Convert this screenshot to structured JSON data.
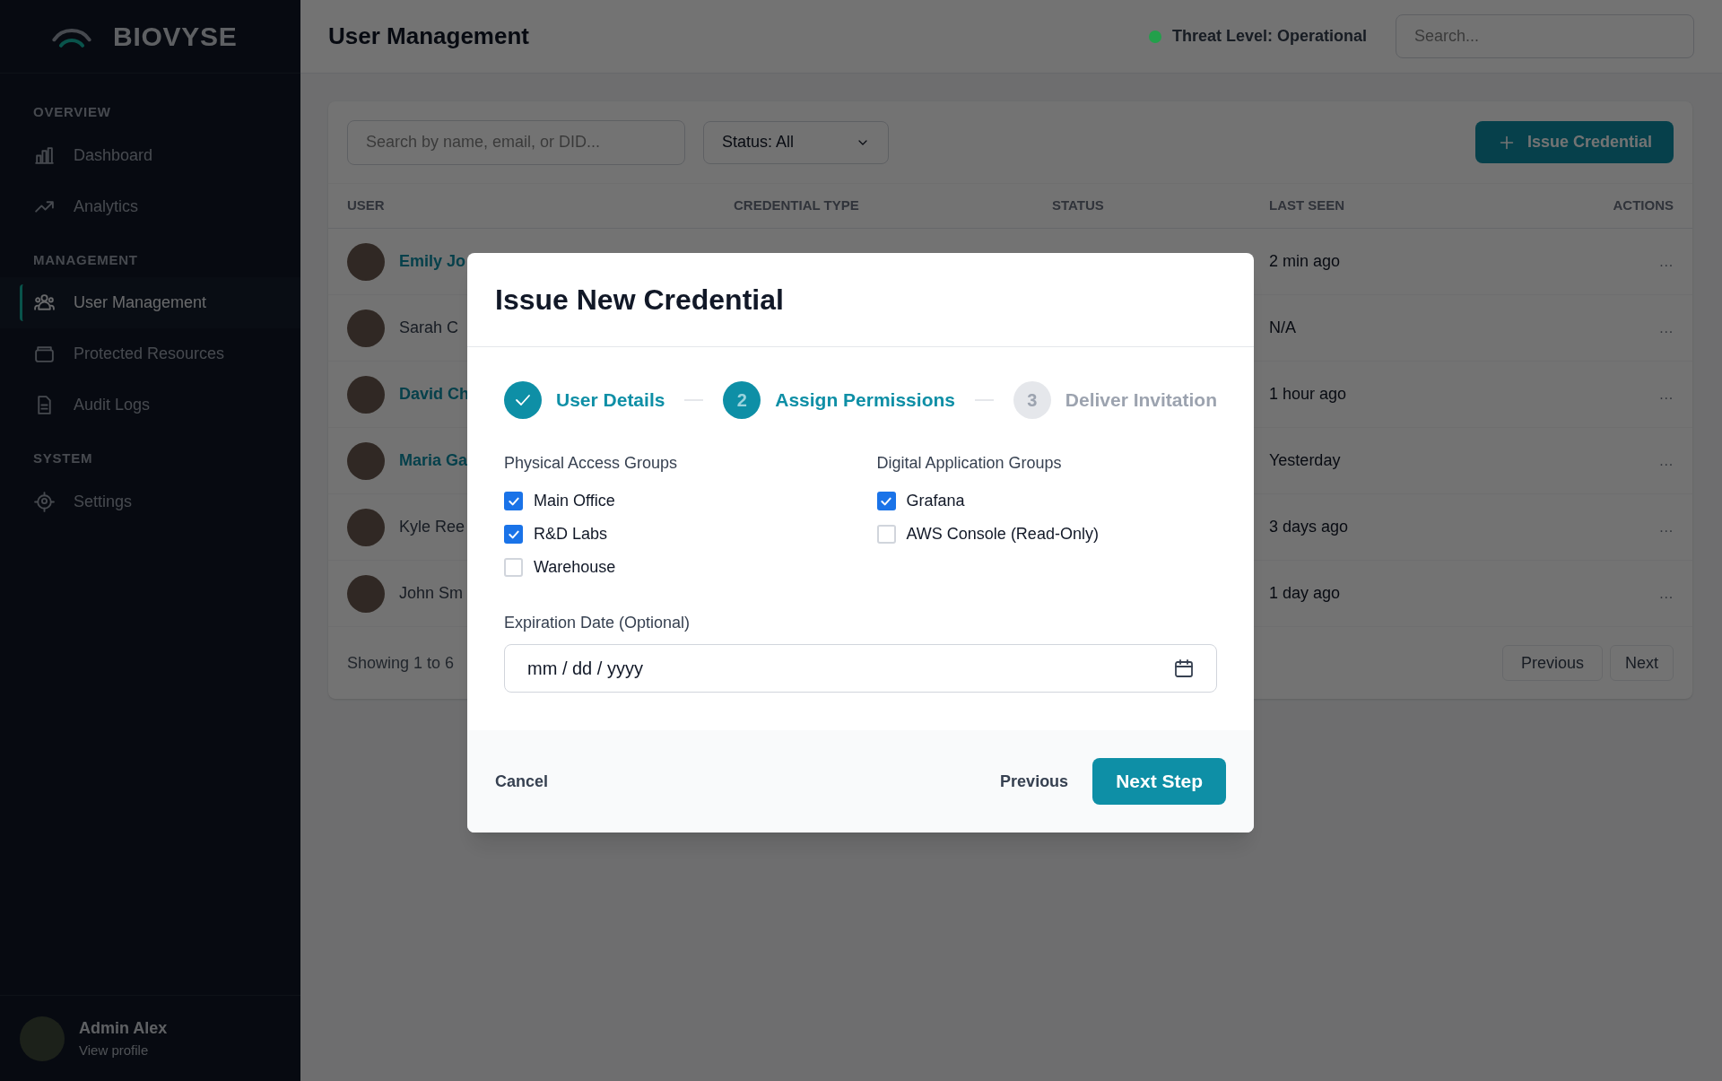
{
  "sidebar": {
    "brand": "BIOVYSE",
    "sections": [
      {
        "title": "OVERVIEW",
        "items": [
          {
            "label": "Dashboard",
            "kind": "bars",
            "selected": false
          },
          {
            "label": "Analytics",
            "kind": "trend",
            "selected": false
          }
        ]
      },
      {
        "title": "MANAGEMENT",
        "items": [
          {
            "label": "User Management",
            "kind": "users",
            "selected": true
          },
          {
            "label": "Protected Resources",
            "kind": "box",
            "selected": false
          },
          {
            "label": "Audit Logs",
            "kind": "doc",
            "selected": false
          }
        ]
      },
      {
        "title": "SYSTEM",
        "items": [
          {
            "label": "Settings",
            "kind": "gear",
            "selected": false
          }
        ]
      }
    ],
    "profile": {
      "name": "Admin Alex",
      "link": "View profile"
    }
  },
  "header": {
    "title": "User Management",
    "threat_status": {
      "label": "Threat Level: Operational",
      "color": "#22a04b"
    },
    "search": {
      "placeholder": "Search..."
    }
  },
  "toolbar": {
    "search": {
      "placeholder": "Search by name, email, or DID..."
    },
    "status_filter": "Status: All",
    "issue_button": "Issue Credential"
  },
  "table": {
    "columns": [
      "USER",
      "CREDENTIAL TYPE",
      "STATUS",
      "LAST SEEN",
      "ACTIONS"
    ],
    "rows": [
      {
        "user": "Emily Jo",
        "highlighted": true,
        "last_seen": "2 min ago",
        "actions": "..."
      },
      {
        "user": "Sarah C",
        "highlighted": false,
        "last_seen": "N/A",
        "actions": "..."
      },
      {
        "user": "David Ch",
        "highlighted": true,
        "last_seen": "1 hour ago",
        "actions": "..."
      },
      {
        "user": "Maria Ga",
        "highlighted": true,
        "last_seen": "Yesterday",
        "actions": "..."
      },
      {
        "user": "Kyle Ree",
        "highlighted": false,
        "last_seen": "3 days ago",
        "actions": "..."
      },
      {
        "user": "John Sm",
        "highlighted": false,
        "last_seen": "1 day ago",
        "actions": "..."
      }
    ]
  },
  "pagination": {
    "summary": "Showing 1 to 6",
    "previous": "Previous",
    "next": "Next"
  },
  "dialog": {
    "title": "Issue New Credential",
    "steps": [
      {
        "label": "User Details",
        "completed": true
      },
      {
        "label": "Assign Permissions",
        "number": "2",
        "completed": false,
        "selected": true
      },
      {
        "label": "Deliver Invitation",
        "number": "3",
        "completed": false,
        "selected": false
      }
    ],
    "groups": [
      {
        "title": "Physical Access Groups",
        "options": [
          {
            "label": "Main Office",
            "checked": true
          },
          {
            "label": "R&D Labs",
            "checked": true
          },
          {
            "label": "Warehouse",
            "checked": false
          }
        ]
      },
      {
        "title": "Digital Application Groups",
        "options": [
          {
            "label": "Grafana",
            "checked": true
          },
          {
            "label": "AWS Console (Read-Only)",
            "checked": false
          }
        ]
      }
    ],
    "expiration": {
      "label": "Expiration Date (Optional)",
      "placeholder": "mm / dd / yyyy"
    },
    "cancel": "Cancel",
    "previous": "Previous",
    "next": "Next Step"
  }
}
